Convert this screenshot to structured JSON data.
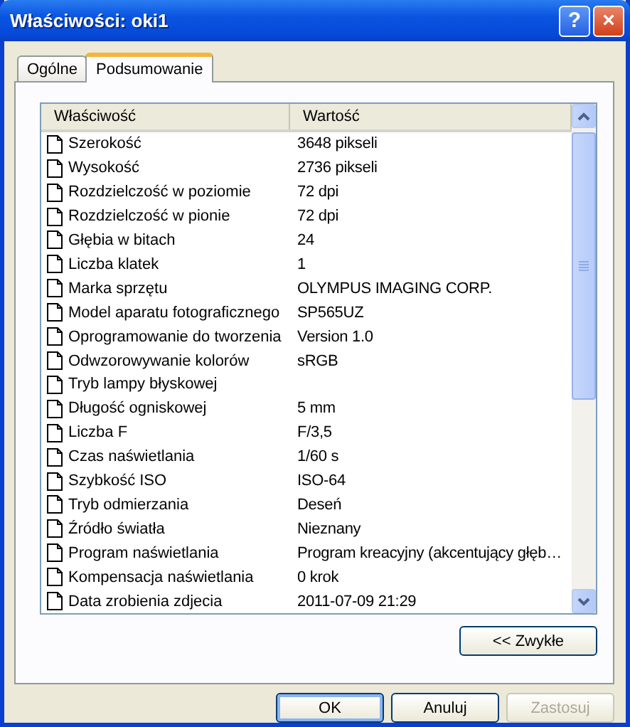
{
  "window": {
    "title": "Właściwości: oki1",
    "title_buttons": [
      "?",
      "×"
    ]
  },
  "tabs": [
    {
      "label": "Ogólne",
      "selected": false
    },
    {
      "label": "Podsumowanie",
      "selected": true
    }
  ],
  "table": {
    "columns": [
      "Właściwość",
      "Wartość"
    ],
    "rows": [
      {
        "property": "Szerokość",
        "value": "3648 pikseli"
      },
      {
        "property": "Wysokość",
        "value": "2736 pikseli"
      },
      {
        "property": "Rozdzielczość w poziomie",
        "value": "72 dpi"
      },
      {
        "property": "Rozdzielczość w pionie",
        "value": "72 dpi"
      },
      {
        "property": "Głębia w bitach",
        "value": "24"
      },
      {
        "property": "Liczba klatek",
        "value": "1"
      },
      {
        "property": "Marka sprzętu",
        "value": "OLYMPUS IMAGING CORP."
      },
      {
        "property": "Model aparatu fotograficznego",
        "value": "SP565UZ"
      },
      {
        "property": "Oprogramowanie do tworzenia",
        "value": "Version 1.0"
      },
      {
        "property": "Odwzorowywanie kolorów",
        "value": "sRGB"
      },
      {
        "property": "Tryb lampy błyskowej"
      },
      {
        "property": "Długość ogniskowej",
        "value": "5 mm"
      },
      {
        "property": "Liczba F",
        "value": "F/3,5"
      },
      {
        "property": "Czas naświetlania",
        "value": "1/60 s"
      },
      {
        "property": "Szybkość ISO",
        "value": "ISO-64"
      },
      {
        "property": "Tryb odmierzania",
        "value": "Deseń"
      },
      {
        "property": "Źródło światła",
        "value": "Nieznany"
      },
      {
        "property": "Program naświetlania",
        "value": "Program kreacyjny (akcentujący głęb…"
      },
      {
        "property": "Kompensacja naświetlania",
        "value": "0 krok"
      },
      {
        "property": "Data zrobienia zdjecia",
        "value": "2011-07-09 21:29"
      }
    ]
  },
  "simple_button": "<< Zwykłe",
  "buttons": [
    {
      "label": "OK",
      "default": true,
      "disabled": false
    },
    {
      "label": "Anuluj",
      "default": false,
      "disabled": false
    },
    {
      "label": "Zastosuj",
      "default": false,
      "disabled": true
    }
  ]
}
